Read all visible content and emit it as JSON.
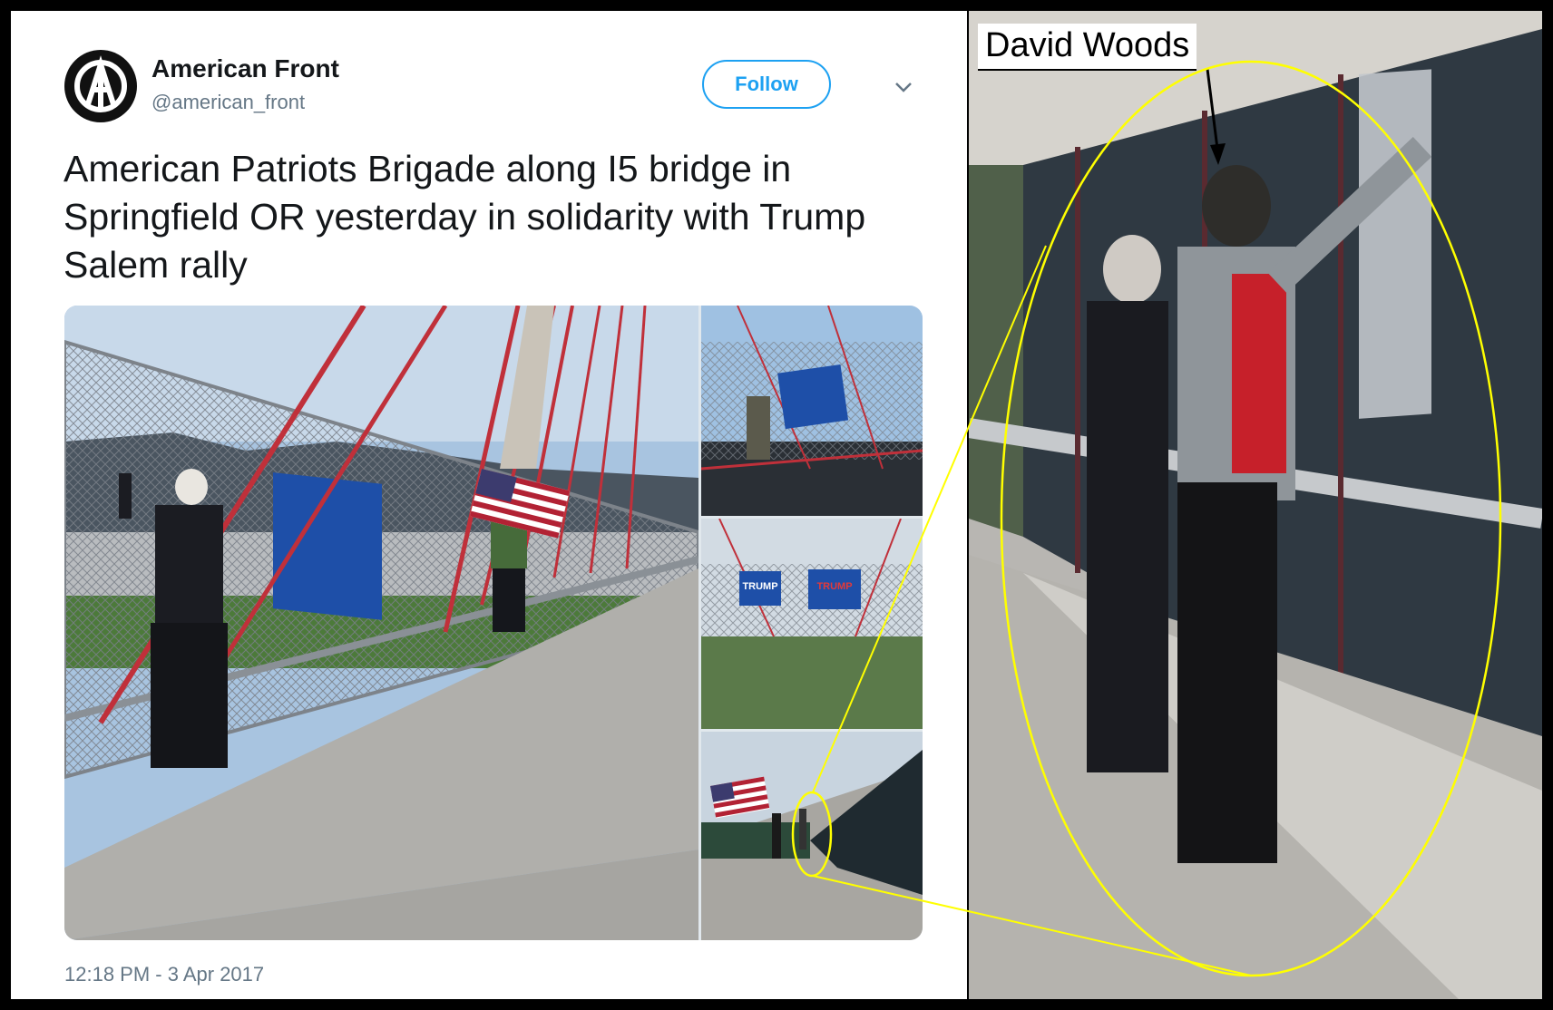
{
  "tweet": {
    "author_name": "American Front",
    "author_handle": "@american_front",
    "follow_label": "Follow",
    "text": "American Patriots Brigade along I5 bridge in Springfield OR yesterday in solidarity with Trump Salem rally",
    "timestamp": "12:18 PM - 3 Apr 2017",
    "media": {
      "sign_1_text": "TRUMP",
      "sign_2_text": "TRUMP"
    }
  },
  "annotation": {
    "label": "David Woods",
    "highlight_color": "#ffff00"
  },
  "colors": {
    "twitter_blue": "#1da1f2",
    "text_dark": "#14171a",
    "text_gray": "#657786",
    "cable_red": "#c0303a",
    "sign_blue": "#1e4fa8"
  }
}
